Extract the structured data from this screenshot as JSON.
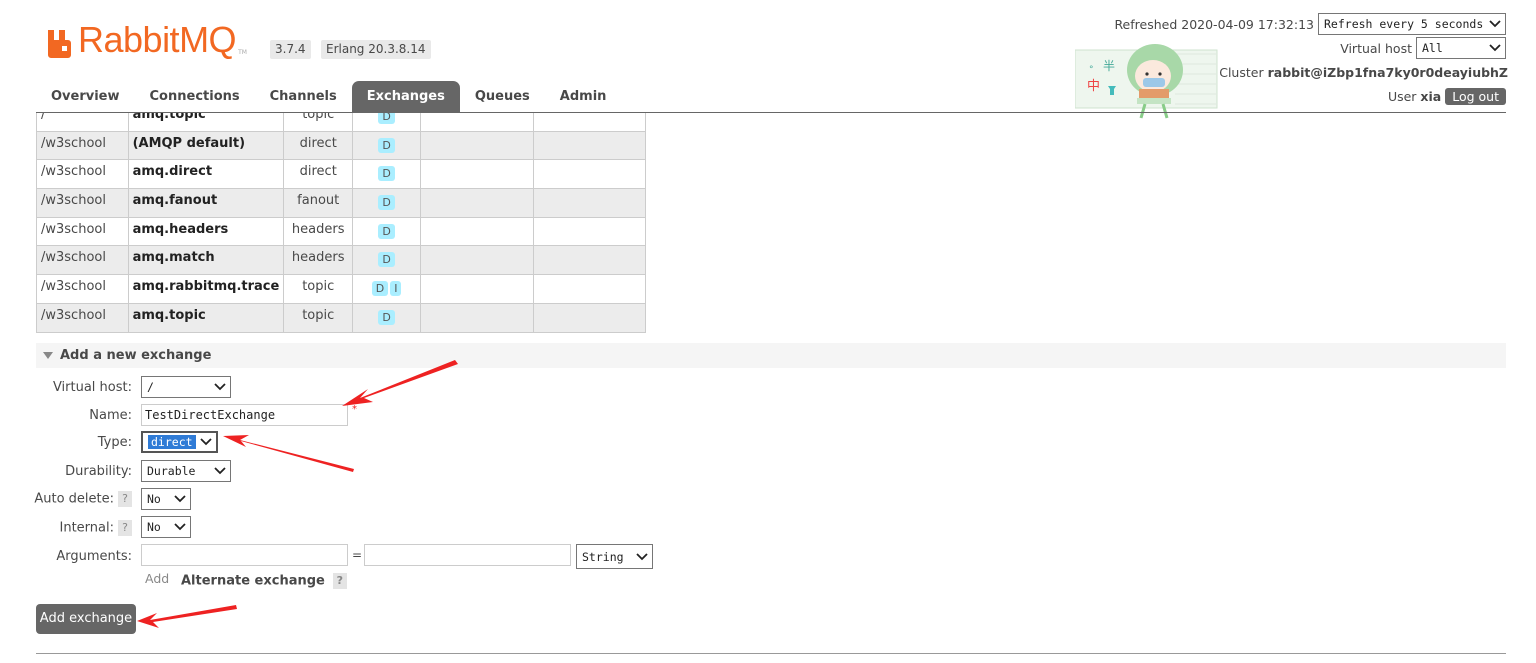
{
  "header": {
    "brand": "RabbitMQ",
    "tm": "TM",
    "version": "3.7.4",
    "erlang": "Erlang 20.3.8.14",
    "refreshed_label": "Refreshed 2020-04-09 17:32:13",
    "refresh_select": "Refresh every 5 seconds",
    "vhost_label": "Virtual host",
    "vhost_select": "All",
    "cluster_label": "Cluster",
    "cluster_name": "rabbit@iZbp1fna7ky0r0deayiubhZ",
    "user_label": "User",
    "user_name": "xia",
    "logout": "Log out",
    "mascot_chars": [
      "°",
      "半",
      "中"
    ]
  },
  "tabs": [
    "Overview",
    "Connections",
    "Channels",
    "Exchanges",
    "Queues",
    "Admin"
  ],
  "active_tab": "Exchanges",
  "exchanges": [
    {
      "vhost": "/",
      "name": "amq.topic",
      "type": "topic",
      "features": [
        "D"
      ]
    },
    {
      "vhost": "/w3school",
      "name": "(AMQP default)",
      "type": "direct",
      "features": [
        "D"
      ]
    },
    {
      "vhost": "/w3school",
      "name": "amq.direct",
      "type": "direct",
      "features": [
        "D"
      ]
    },
    {
      "vhost": "/w3school",
      "name": "amq.fanout",
      "type": "fanout",
      "features": [
        "D"
      ]
    },
    {
      "vhost": "/w3school",
      "name": "amq.headers",
      "type": "headers",
      "features": [
        "D"
      ]
    },
    {
      "vhost": "/w3school",
      "name": "amq.match",
      "type": "headers",
      "features": [
        "D"
      ]
    },
    {
      "vhost": "/w3school",
      "name": "amq.rabbitmq.trace",
      "type": "topic",
      "features": [
        "D",
        "I"
      ]
    },
    {
      "vhost": "/w3school",
      "name": "amq.topic",
      "type": "topic",
      "features": [
        "D"
      ]
    }
  ],
  "add_section": {
    "title": "Add a new exchange",
    "labels": {
      "virtual_host": "Virtual host:",
      "name": "Name:",
      "type": "Type:",
      "durability": "Durability:",
      "auto_delete": "Auto delete:",
      "internal": "Internal:",
      "arguments": "Arguments:"
    },
    "values": {
      "virtual_host": "/",
      "name": "TestDirectExchange",
      "type": "direct",
      "durability": "Durable",
      "auto_delete": "No",
      "internal": "No",
      "arg_type": "String"
    },
    "required_mark": "*",
    "help_mark": "?",
    "equals": "=",
    "add_link": "Add",
    "alternate_exchange": "Alternate exchange",
    "submit": "Add exchange"
  },
  "colors": {
    "brand": "#f26822",
    "tab_active": "#666666",
    "badge": "#aaeeff",
    "annotation_arrow": "#ee2222"
  }
}
